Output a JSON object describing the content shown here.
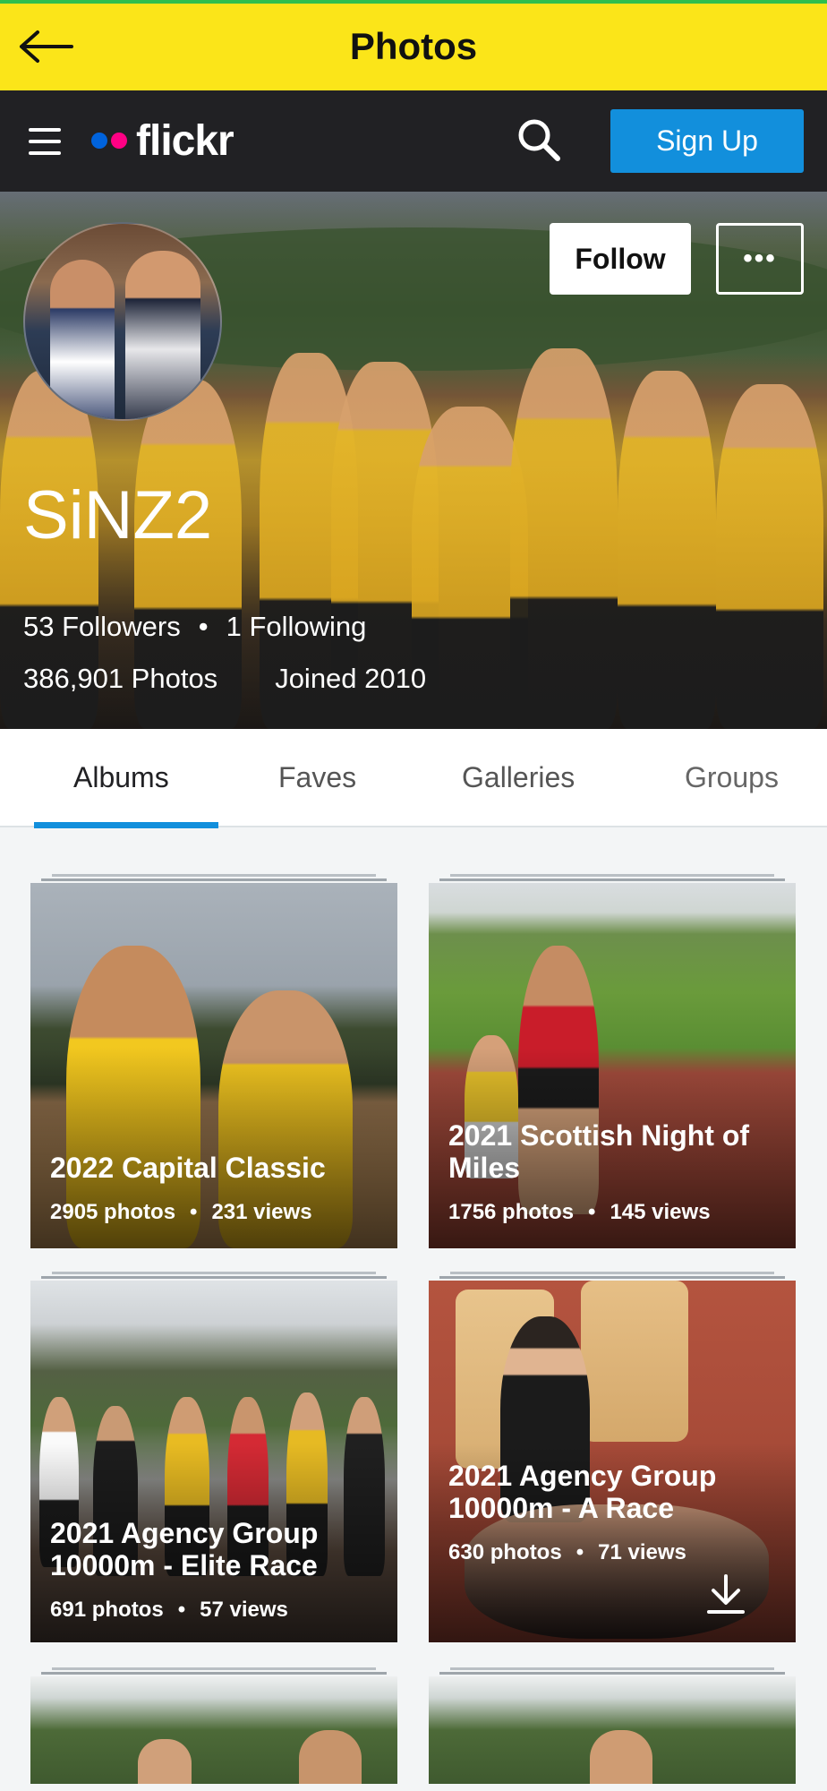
{
  "topbar": {
    "title": "Photos",
    "back_icon": "arrow-left-icon"
  },
  "header": {
    "logo_text": "flickr",
    "menu_icon": "hamburger-icon",
    "search_icon": "search-icon",
    "signup_label": "Sign Up",
    "colors": {
      "header_bg": "#212124",
      "signup_bg": "#128fdc",
      "logo_blue": "#0063dc",
      "logo_pink": "#ff0084"
    }
  },
  "profile": {
    "username": "SiNZ2",
    "followers": "53 Followers",
    "following": "1 Following",
    "photos": "386,901 Photos",
    "joined": "Joined 2010",
    "follow_label": "Follow",
    "more_label": "•••"
  },
  "tabs": [
    {
      "label": "Albums",
      "active": true
    },
    {
      "label": "Faves",
      "active": false
    },
    {
      "label": "Galleries",
      "active": false
    },
    {
      "label": "Groups",
      "active": false
    }
  ],
  "albums": [
    {
      "title": "2022 Capital Classic",
      "photos": "2905 photos",
      "views": "231 views"
    },
    {
      "title": "2021 Scottish Night of Miles",
      "photos": "1756 photos",
      "views": "145 views"
    },
    {
      "title": "2021 Agency Group 10000m - Elite Race",
      "photos": "691 photos",
      "views": "57 views"
    },
    {
      "title": "2021 Agency Group 10000m - A Race",
      "photos": "630 photos",
      "views": "71 views"
    }
  ],
  "accent_color": "#fbe519"
}
